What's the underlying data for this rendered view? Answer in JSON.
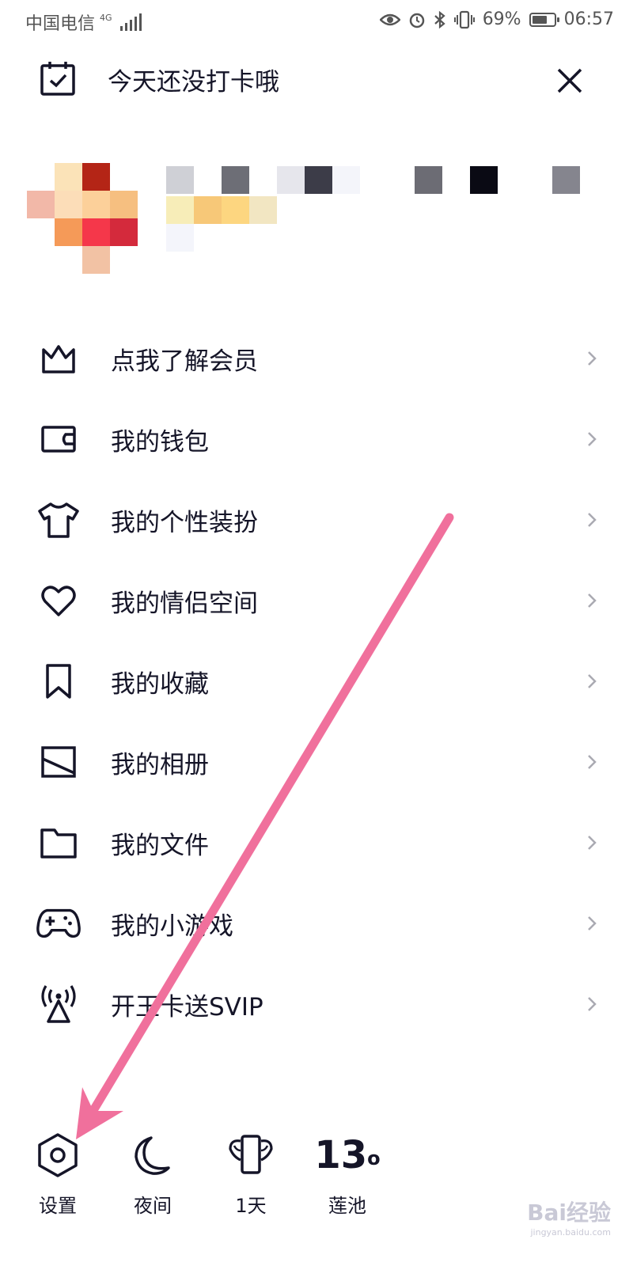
{
  "status_bar": {
    "carrier": "中国电信",
    "network": "4G",
    "battery_percent": "69%",
    "battery_level": 0.69,
    "time": "06:57",
    "icons": [
      "eye-icon",
      "alarm-icon",
      "bluetooth-icon",
      "vibrate-icon"
    ]
  },
  "checkin": {
    "label": "今天还没打卡哦",
    "icon": "calendar-check-icon",
    "close_icon": "close-icon"
  },
  "menu": {
    "items": [
      {
        "label": "点我了解会员",
        "icon": "crown-icon"
      },
      {
        "label": "我的钱包",
        "icon": "wallet-icon"
      },
      {
        "label": "我的个性装扮",
        "icon": "tshirt-icon"
      },
      {
        "label": "我的情侣空间",
        "icon": "heart-icon"
      },
      {
        "label": "我的收藏",
        "icon": "bookmark-icon"
      },
      {
        "label": "我的相册",
        "icon": "image-icon"
      },
      {
        "label": "我的文件",
        "icon": "folder-icon"
      },
      {
        "label": "我的小游戏",
        "icon": "gamepad-icon"
      },
      {
        "label": "开王卡送SVIP",
        "icon": "broadcast-tower-icon"
      }
    ]
  },
  "bottom_bar": {
    "settings": "设置",
    "night": "夜间",
    "days": "1天",
    "temperature": "13",
    "temperature_unit": "o",
    "location": "莲池"
  },
  "watermark": {
    "brand": "Bai经验",
    "url": "jingyan.baidu.com"
  },
  "colors": {
    "text": "#151528",
    "arrow": "#f0709c"
  }
}
